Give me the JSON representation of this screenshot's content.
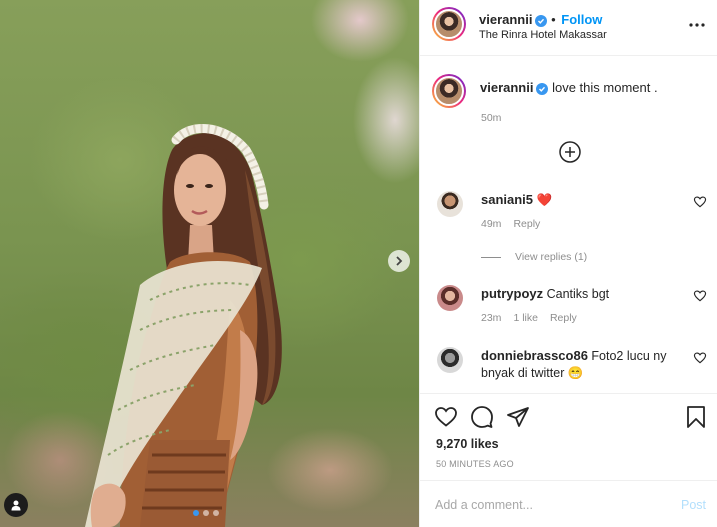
{
  "post": {
    "username": "vierannii",
    "follow_label": "Follow",
    "location": "The Rinra Hotel Makassar",
    "more_icon": "more-horizontal-icon"
  },
  "caption": {
    "username": "vierannii",
    "text": "love this moment .",
    "time": "50m"
  },
  "comments": [
    {
      "username": "saniani5",
      "text": "❤️",
      "time": "49m",
      "reply_label": "Reply",
      "view_replies": "View replies (1)"
    },
    {
      "username": "putrypoyz",
      "text": "Cantiks bgt",
      "time": "23m",
      "likes": "1 like",
      "reply_label": "Reply"
    },
    {
      "username": "donniebrassco86",
      "text": "Foto2 lucu ny bnyak di twitter 😁"
    }
  ],
  "actions": {
    "likes": "9,270 likes",
    "posted_ago": "50 MINUTES AGO"
  },
  "composer": {
    "placeholder": "Add a comment...",
    "post_label": "Post"
  },
  "carousel": {
    "slide_count": 3,
    "active_index": 0
  },
  "colors": {
    "accent": "#0095f6",
    "verified": "#3897f0",
    "muted": "#8e8e8e",
    "heart_red": "#ed4956"
  }
}
